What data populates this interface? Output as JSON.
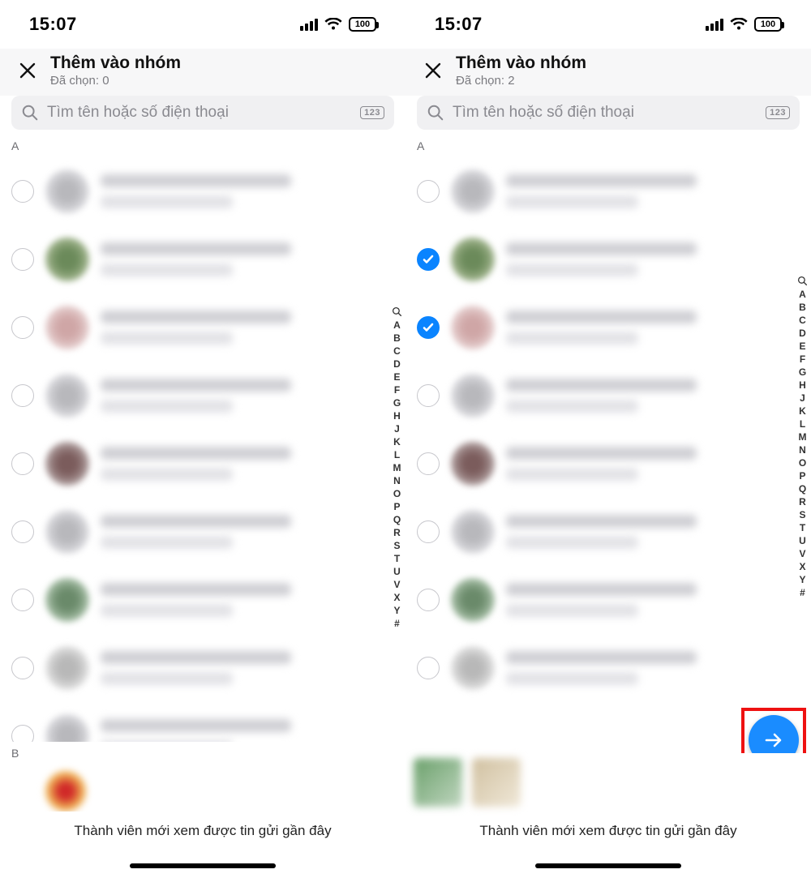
{
  "status": {
    "time": "15:07",
    "battery": "100"
  },
  "header": {
    "title": "Thêm vào nhóm",
    "selected_prefix": "Đã chọn: ",
    "left_count": 0,
    "right_count": 2
  },
  "search": {
    "placeholder": "Tìm tên hoặc số điện thoại",
    "badge": "123"
  },
  "sections": {
    "A": "A",
    "B": "B"
  },
  "alpha_index": [
    "A",
    "B",
    "C",
    "D",
    "E",
    "F",
    "G",
    "H",
    "J",
    "K",
    "L",
    "M",
    "N",
    "O",
    "P",
    "Q",
    "R",
    "S",
    "T",
    "U",
    "V",
    "X",
    "Y",
    "#"
  ],
  "contacts_left": [
    false,
    false,
    false,
    false,
    false,
    false,
    false,
    false,
    false
  ],
  "contacts_right": [
    false,
    true,
    true,
    false,
    false,
    false,
    false,
    false,
    false
  ],
  "footer": {
    "notice": "Thành viên mới xem được tin gửi gần đây"
  }
}
